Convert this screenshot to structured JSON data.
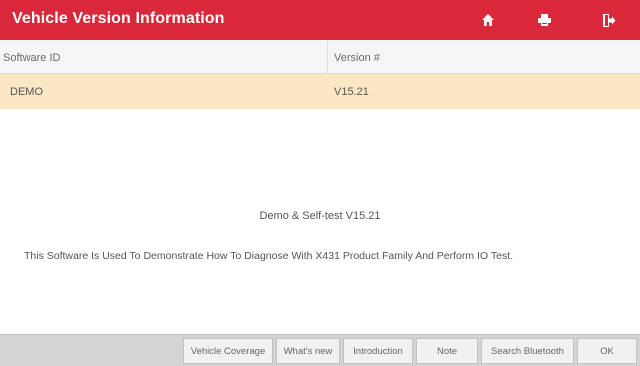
{
  "header": {
    "title": "Vehicle Version Information",
    "icons": [
      "home-icon",
      "print-icon",
      "exit-icon"
    ]
  },
  "table": {
    "columns": [
      "Software ID",
      "Version #"
    ],
    "rows": [
      {
        "software_id": "DEMO",
        "version": "V15.21"
      }
    ]
  },
  "content": {
    "heading": "Demo & Self-test V15.21",
    "description": "This Software Is Used To Demonstrate How To Diagnose With X431 Product Family And Perform IO Test."
  },
  "footer": {
    "buttons": [
      "Vehicle Coverage",
      "What's new",
      "Introduction",
      "Note",
      "Search Bluetooth",
      "OK"
    ]
  },
  "colors": {
    "header_bg": "#d9283a",
    "selected_row_bg": "#fbe7c3",
    "footer_bg": "#d4d4d4"
  }
}
